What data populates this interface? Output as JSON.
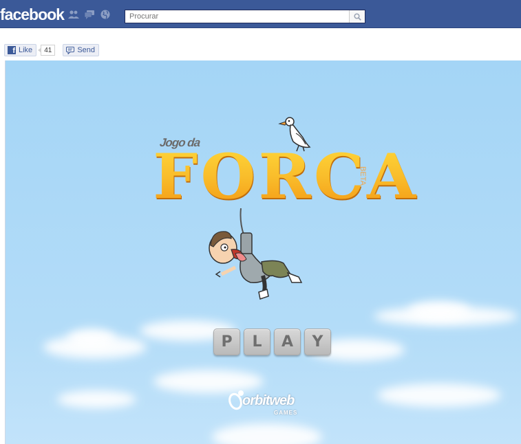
{
  "header": {
    "logo": "facebook",
    "jewels": [
      "friend-requests-icon",
      "messages-icon",
      "notifications-globe-icon"
    ],
    "search": {
      "placeholder": "Procurar",
      "value": "Procurar"
    }
  },
  "social": {
    "like_label": "Like",
    "like_count": "41",
    "send_label": "Send"
  },
  "game": {
    "title_small": "Jogo da",
    "title_big": "FORCA",
    "beta": "BETA",
    "play_tiles": [
      "P",
      "L",
      "A",
      "Y"
    ],
    "studio_name": "orbitweb",
    "studio_sub": "GAMES"
  },
  "colors": {
    "facebook_blue": "#3b5998",
    "sky": "#a4d5f6",
    "title_orange": "#f7a91a"
  }
}
